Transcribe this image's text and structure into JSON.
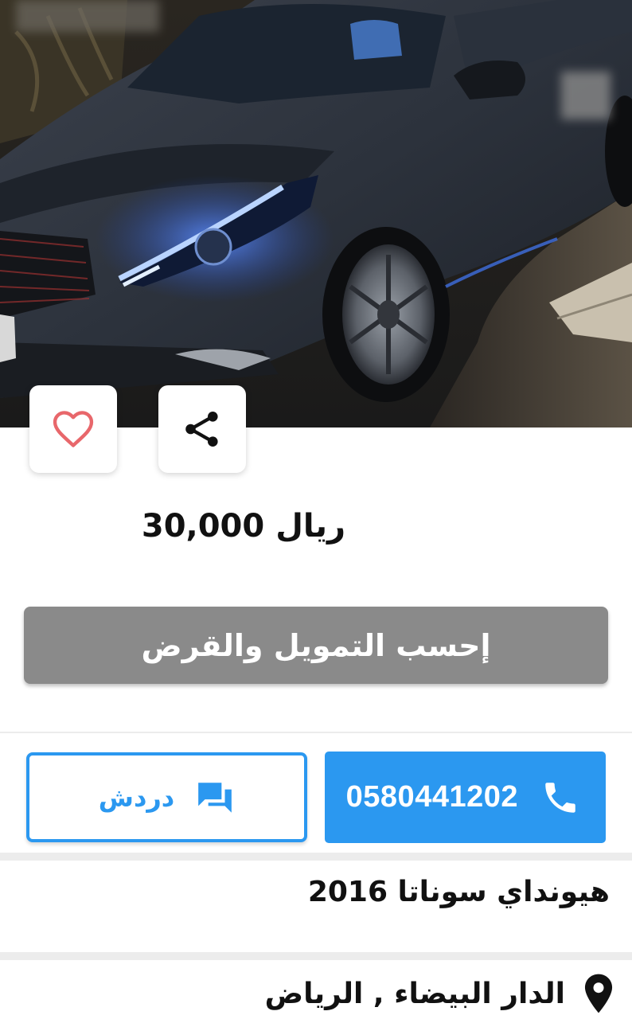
{
  "listing": {
    "price_amount": "30,000",
    "price_currency": "ريال",
    "title": "هيونداي سوناتا 2016",
    "location": "الدار البيضاء , الرياض"
  },
  "actions": {
    "finance_label": "إحسب التمويل والقرض",
    "phone_number": "0580441202",
    "chat_label": "دردش"
  },
  "icons": {
    "favorite": "heart-icon",
    "share": "share-icon",
    "phone": "phone-icon",
    "chat": "chat-icon",
    "location": "location-pin-icon"
  },
  "colors": {
    "accent": "#2b98f0",
    "finance_button": "#8a8a8a",
    "heart": "#e8676b"
  }
}
